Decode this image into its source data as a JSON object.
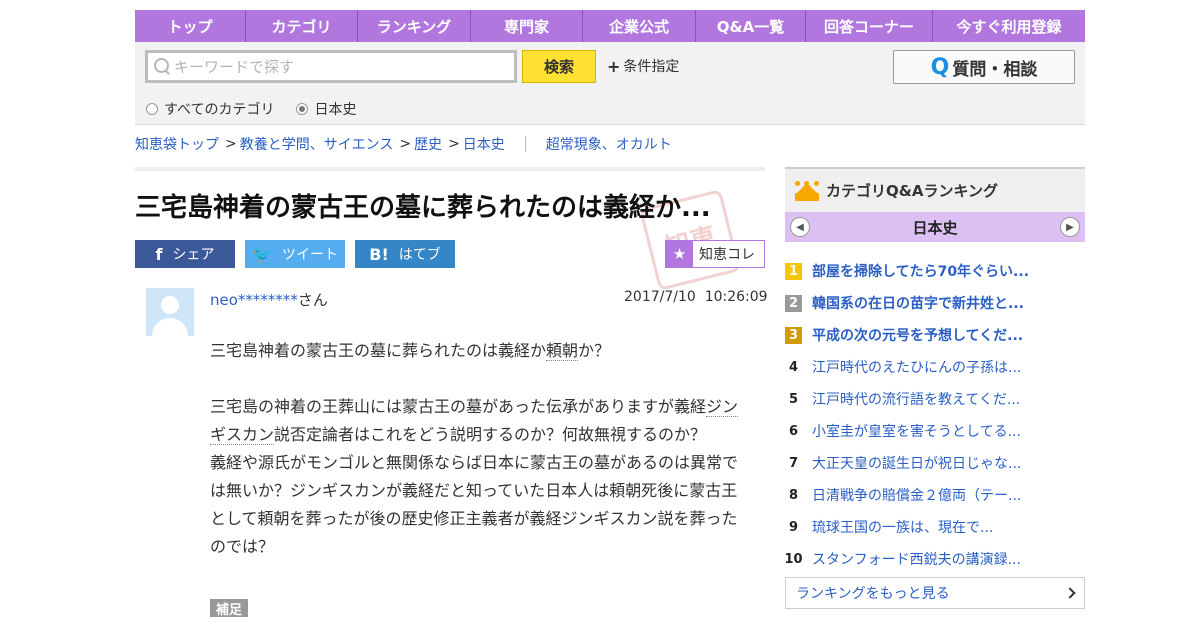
{
  "nav": {
    "items": [
      "トップ",
      "カテゴリ",
      "ランキング",
      "専門家",
      "企業公式",
      "Q&A一覧",
      "回答コーナー",
      "今すぐ利用登録"
    ]
  },
  "search": {
    "placeholder": "キーワードで探す",
    "button_label": "検索",
    "condition_label": "条件指定",
    "ask_label": "質問・相談",
    "ask_icon": "Q",
    "scope_all": "すべてのカテゴリ",
    "scope_current": "日本史",
    "selected_scope": "日本史"
  },
  "breadcrumb": {
    "items": [
      "知恵袋トップ",
      "教養と学問、サイエンス",
      "歴史",
      "日本史"
    ],
    "related": "超常現象、オカルト"
  },
  "question": {
    "title": "三宅島神着の蒙古王の墓に葬られたのは義経か...",
    "share_facebook": "シェア",
    "share_twitter": "ツイート",
    "share_hatena": "はてブ",
    "chiekore": "知恵コレ",
    "user_name": "neo********",
    "user_suffix": "さん",
    "date": "2017/7/10",
    "time": "10:26:09",
    "line1a": "三宅島神着の蒙古王の墓に葬られたのは義経か",
    "line1b": "頼朝",
    "line1c": "か？",
    "p2a": "三宅島の神着の王葬山には蒙古王の墓があった伝承がありますが義経",
    "p2b": "ジンギスカン",
    "p2c": "説否定論者はこれをどう説明するのか？何故無視するのか？",
    "p3": "義経や源氏がモンゴルと無関係ならば日本に蒙古王の墓があるのは異常では無いか？ジンギスカンが義経だと知っていた日本人は頼朝死後に蒙古王として頼朝を葬ったが後の歴史修正主義者が義経ジンギスカン説を葬ったのでは？",
    "supplement_label": "補足"
  },
  "ranking": {
    "heading": "カテゴリQ&Aランキング",
    "category": "日本史",
    "items": [
      {
        "rank": "1",
        "title": "部屋を掃除してたら70年ぐらい..."
      },
      {
        "rank": "2",
        "title": "韓国系の在日の苗字で新井姓と..."
      },
      {
        "rank": "3",
        "title": "平成の次の元号を予想してくだ..."
      },
      {
        "rank": "4",
        "title": "江戸時代のえたひにんの子孫は..."
      },
      {
        "rank": "5",
        "title": "江戸時代の流行語を教えてくだ..."
      },
      {
        "rank": "6",
        "title": "小室圭が皇室を害そうとしてる..."
      },
      {
        "rank": "7",
        "title": "大正天皇の誕生日が祝日じゃな..."
      },
      {
        "rank": "8",
        "title": "日清戦争の賠償金２億両（テー..."
      },
      {
        "rank": "9",
        "title": "琉球王国の一族は、現在で..."
      },
      {
        "rank": "10",
        "title": "スタンフォード西鋭夫の講演録..."
      }
    ],
    "more_label": "ランキングをもっと見る"
  },
  "colors": {
    "nav": "#b277de",
    "link": "#2a5fc4",
    "search_button": "#ffe033",
    "facebook": "#3b5998",
    "twitter": "#55acee",
    "hatena": "#3586c7"
  }
}
